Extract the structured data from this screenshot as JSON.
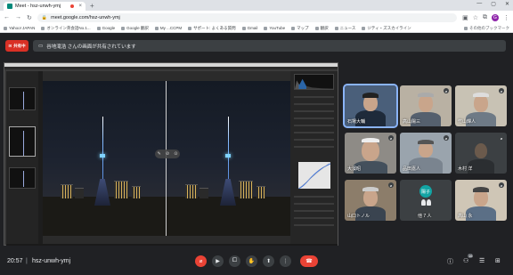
{
  "browser": {
    "tab_title": "Meet - hsz-unwh-ymj",
    "url": "meet.google.com/hsz-unwh-ymj",
    "profile_initial": "G",
    "bookmarks": [
      "Yahoo! JAPAN",
      "オンライン英会話No.1...",
      "Google",
      "Google 翻訳",
      "My ...CCPM",
      "サポート: よくある質問",
      "Gmail",
      "YouTube",
      "マップ",
      "翻訳",
      "ニュース",
      "ジティ・ズスカイライン"
    ],
    "other_bookmarks": "その他のブックマーク"
  },
  "meet": {
    "present_button": "共有中",
    "present_banner": "谷地滝浩 さんの画面が共有されています",
    "meeting_time": "20:57",
    "meeting_code": "hsz-unwh-ymj",
    "participant_count": "16"
  },
  "participants": [
    {
      "name": "石場大輔"
    },
    {
      "name": "高山陽三"
    },
    {
      "name": "竹山輝人"
    },
    {
      "name": "大濱昭"
    },
    {
      "name": "品田嘉人"
    },
    {
      "name": "木村 洋"
    },
    {
      "name": "山口トノル"
    },
    {
      "name": "他 7 人",
      "initials": "陽子"
    },
    {
      "name": "高山 永"
    }
  ],
  "colors": {
    "present_red": "#d93025",
    "end_call_red": "#ea4335",
    "active_speaker": "#8ab4f8"
  }
}
